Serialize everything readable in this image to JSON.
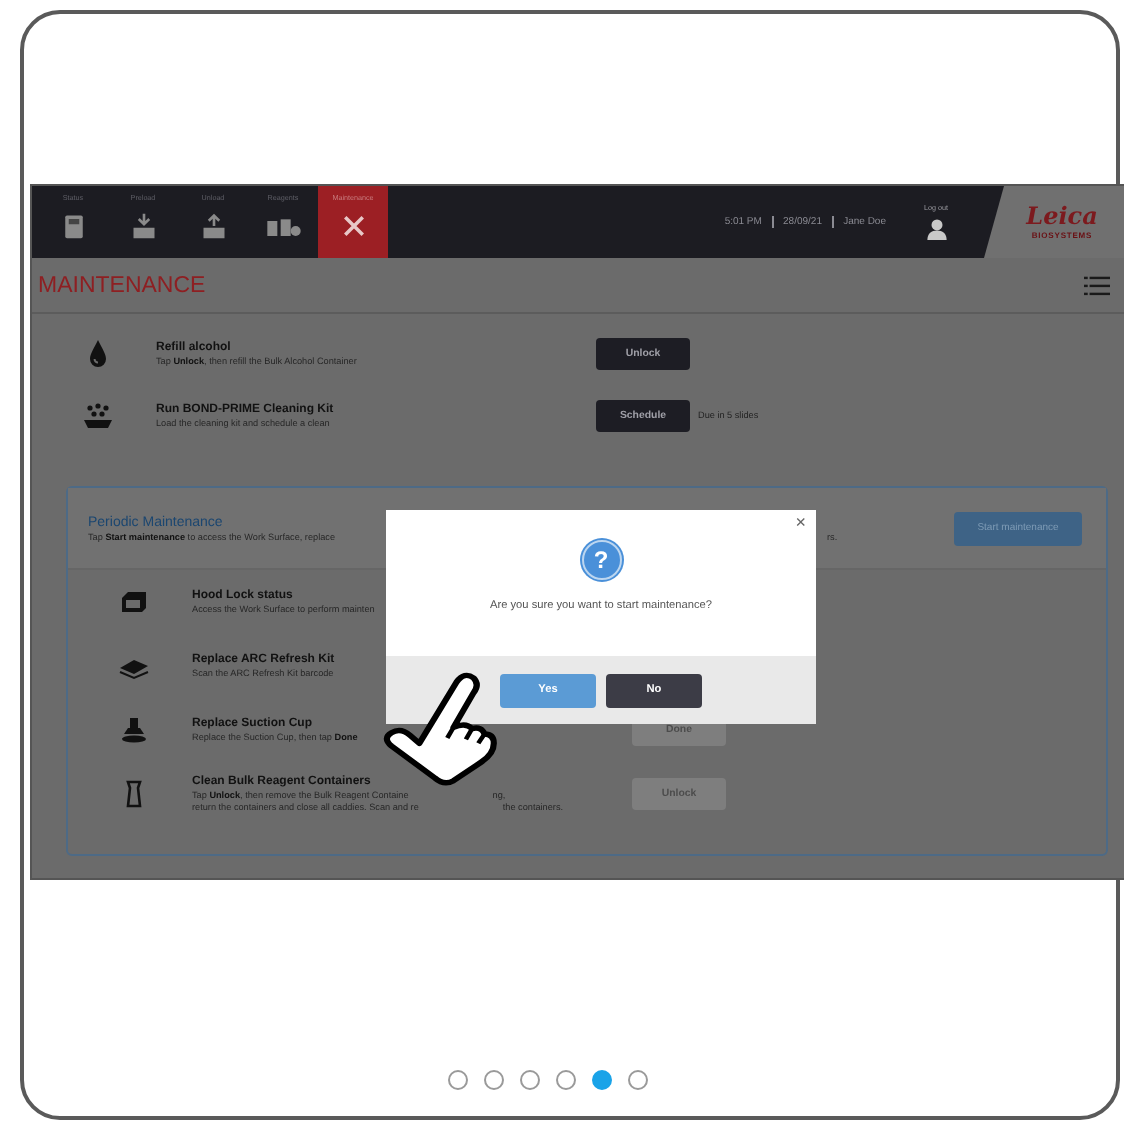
{
  "header": {
    "tabs": [
      {
        "label": "Status",
        "selected": false
      },
      {
        "label": "Preload",
        "selected": false
      },
      {
        "label": "Unload",
        "selected": false
      },
      {
        "label": "Reagents",
        "selected": false
      },
      {
        "label": "Maintenance",
        "selected": true
      }
    ],
    "time": "5:01 PM",
    "date": "28/09/21",
    "user": "Jane Doe",
    "logout": "Log out",
    "logo": "Leica",
    "logo_sub": "BIOSYSTEMS"
  },
  "page_title": "MAINTENANCE",
  "tasks": [
    {
      "title": "Refill alcohol",
      "description": [
        [
          "Tap **Unlock**, then refill the Bulk Alcohol Container"
        ]
      ],
      "button": {
        "label": "Unlock",
        "disabled": false
      }
    },
    {
      "title": "Run BOND-PRIME Cleaning Kit",
      "description": [
        [
          "Load the cleaning kit and schedule a clean"
        ]
      ],
      "button": {
        "label": "Schedule",
        "disabled": false
      },
      "note": "Due in 5 slides"
    }
  ],
  "periodic": {
    "title": "Periodic Maintenance",
    "description": [
      "Tap **Start maintenance** to access the Work Surface, replace",
      "rs."
    ],
    "button": "Start maintenance",
    "tasks": [
      {
        "title": "Hood Lock status",
        "description": [
          [
            "Access the Work Surface to perform mainten"
          ]
        ]
      },
      {
        "title": "Replace ARC Refresh Kit",
        "description": [
          [
            "Scan the ARC Refresh Kit barcode"
          ]
        ]
      },
      {
        "title": "Replace Suction Cup",
        "description": [
          [
            "Replace the Suction Cup, then tap **Done**"
          ]
        ],
        "button": {
          "label": "Done",
          "disabled": true
        }
      },
      {
        "title": "Clean Bulk Reagent Containers",
        "description": [
          [
            "Tap **Unlock**, then remove the Bulk Reagent Containe",
            "ng,"
          ],
          [
            "return the containers and close all caddies. Scan and re",
            "the containers."
          ]
        ],
        "button": {
          "label": "Unlock",
          "disabled": true
        }
      }
    ]
  },
  "dialog": {
    "icon": "?",
    "close": "×",
    "message": "Are you sure you want to start maintenance?",
    "buttons": [
      {
        "label": "Yes",
        "kind": "primary"
      },
      {
        "label": "No",
        "kind": "secondary"
      }
    ]
  },
  "carousel": {
    "dots": [
      {
        "selected": false
      },
      {
        "selected": false
      },
      {
        "selected": false
      },
      {
        "selected": false
      },
      {
        "selected": true
      },
      {
        "selected": false
      }
    ]
  }
}
